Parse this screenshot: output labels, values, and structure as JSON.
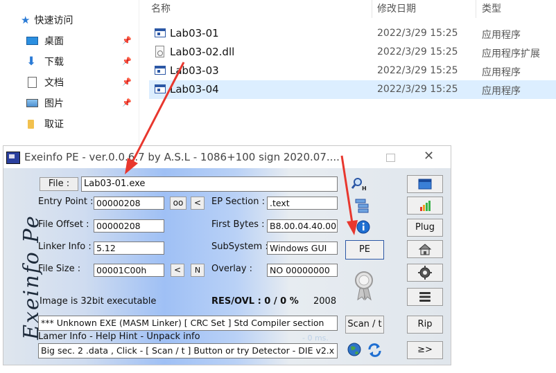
{
  "explorer": {
    "nav": [
      {
        "label": "快速访问",
        "icon": "star-icon",
        "pinned": false
      },
      {
        "label": "桌面",
        "icon": "desktop-icon",
        "pinned": true
      },
      {
        "label": "下载",
        "icon": "download-icon",
        "pinned": true
      },
      {
        "label": "文档",
        "icon": "document-icon",
        "pinned": true
      },
      {
        "label": "图片",
        "icon": "picture-icon",
        "pinned": true
      },
      {
        "label": "取证",
        "icon": "folder-icon",
        "pinned": false
      }
    ],
    "columns": {
      "name": "名称",
      "date": "修改日期",
      "type": "类型"
    },
    "files": [
      {
        "name": "Lab03-01",
        "date": "2022/3/29 15:25",
        "type": "应用程序",
        "icon": "exe-icon",
        "selected": false
      },
      {
        "name": "Lab03-02.dll",
        "date": "2022/3/29 15:25",
        "type": "应用程序扩展",
        "icon": "dll-icon",
        "selected": false
      },
      {
        "name": "Lab03-03",
        "date": "2022/3/29 15:25",
        "type": "应用程序",
        "icon": "exe-icon",
        "selected": false
      },
      {
        "name": "Lab03-04",
        "date": "2022/3/29 15:25",
        "type": "应用程序",
        "icon": "exe-icon",
        "selected": true
      }
    ]
  },
  "exeinfo": {
    "title": "Exeinfo PE - ver.0.0.6.7  by A.S.L -  1086+100 sign  2020.07....",
    "signature": "Exeinfo Pe",
    "file_btn": "File :",
    "file_value": "Lab03-01.exe",
    "entry_point_label": "Entry Point :",
    "entry_point": "00000208",
    "oo_btn": "oo",
    "lt_btn": "<",
    "ep_section_label": "EP Section :",
    "ep_section": ".text",
    "file_offset_label": "File Offset :",
    "file_offset": "00000208",
    "first_bytes_label": "First Bytes :",
    "first_bytes": "B8.00.04.40.00",
    "linker_label": "Linker Info :",
    "linker": "5.12",
    "subsystem_label": "SubSystem :",
    "subsystem": "Windows GUI",
    "file_size_label": "File Size :",
    "file_size": "00001C00h",
    "n_btn": "N",
    "overlay_label": "Overlay :",
    "overlay": "NO  00000000",
    "image_info": "Image is 32bit executable",
    "res_ovl": "RES/OVL : 0 / 0 %",
    "year": "2008",
    "detect_text": "*** Unknown EXE  (MASM Linker)  [ CRC Set ] Std Compiler section",
    "lamer_info": "Lamer Info - Help Hint - Unpack info",
    "hint_text": "Big sec. 2 .data , Click - [ Scan / t ]  Button  or  try Detector - DIE v2.x",
    "timing": "- 0 ms.",
    "pe_btn": "PE",
    "plug_btn": "Plug",
    "scan_btn": "Scan / t",
    "rip_btn": "Rip",
    "next_btn": "≥>",
    "h_label": "H"
  },
  "colors": {
    "arrow": "#e8372e",
    "accent": "#2b57a5",
    "selected_row": "#dceeff"
  }
}
